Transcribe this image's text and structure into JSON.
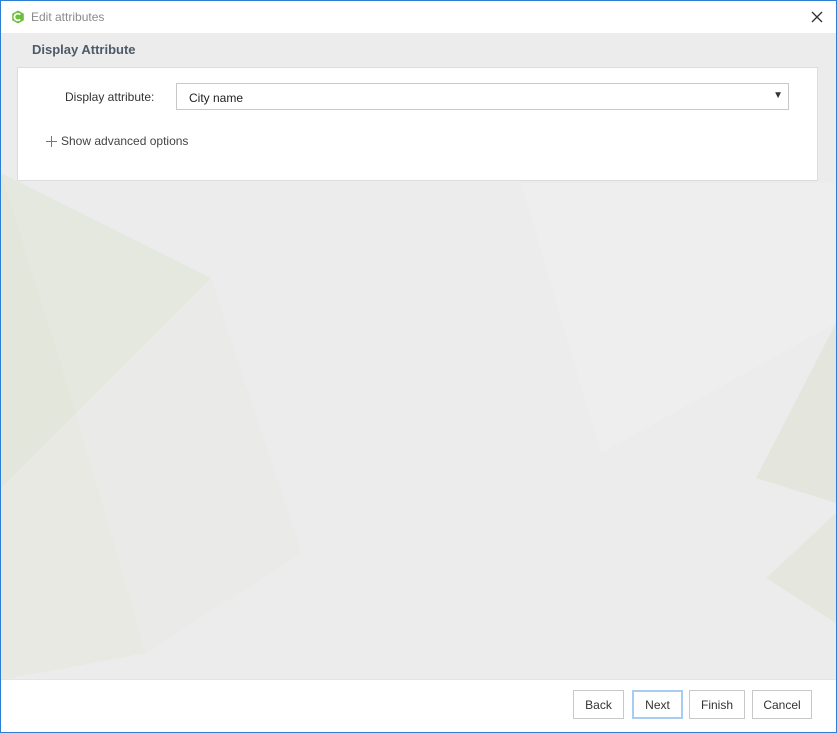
{
  "window": {
    "title": "Edit attributes",
    "app_icon": "app-logo-icon",
    "close_icon": "close-icon",
    "accent_color": "#2b7fd4"
  },
  "section": {
    "title": "Display Attribute"
  },
  "form": {
    "display_attribute_label": "Display attribute:",
    "display_attribute_value": "City name",
    "dropdown_icon": "chevron-down-icon",
    "advanced_toggle_label": "Show advanced options",
    "advanced_icon": "plus-icon"
  },
  "footer": {
    "back_label": "Back",
    "next_label": "Next",
    "finish_label": "Finish",
    "cancel_label": "Cancel"
  }
}
